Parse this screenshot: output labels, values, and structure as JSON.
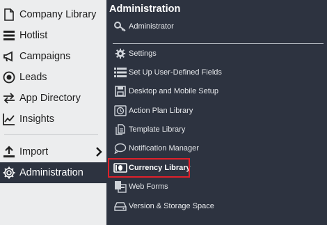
{
  "sidebar": {
    "items": [
      {
        "label": "Company Library",
        "icon": "document-icon"
      },
      {
        "label": "Hotlist",
        "icon": "list-icon"
      },
      {
        "label": "Campaigns",
        "icon": "megaphone-icon"
      },
      {
        "label": "Leads",
        "icon": "target-icon"
      },
      {
        "label": "App Directory",
        "icon": "swap-arrows-icon"
      },
      {
        "label": "Insights",
        "icon": "trend-chart-icon"
      },
      {
        "label": "Import",
        "icon": "upload-icon"
      },
      {
        "label": "Administration",
        "icon": "gear-icon"
      }
    ]
  },
  "flyout": {
    "title": "Administration",
    "items": [
      {
        "label": "Administrator",
        "icon": "key-icon"
      },
      {
        "label": "Settings",
        "icon": "gear-icon"
      },
      {
        "label": "Set Up User-Defined Fields",
        "icon": "list-icon"
      },
      {
        "label": "Desktop and Mobile Setup",
        "icon": "floppy-icon"
      },
      {
        "label": "Action Plan Library",
        "icon": "clock-icon"
      },
      {
        "label": "Template Library",
        "icon": "template-icon"
      },
      {
        "label": "Notification Manager",
        "icon": "chat-bubble-icon"
      },
      {
        "label": "Currency Library",
        "icon": "money-icon"
      },
      {
        "label": "Web Forms",
        "icon": "web-forms-icon"
      },
      {
        "label": "Version & Storage Space",
        "icon": "drive-icon"
      }
    ]
  },
  "colors": {
    "sidebar_bg": "#ecedee",
    "panel_bg": "#2d3340",
    "highlight": "#e0202a"
  }
}
